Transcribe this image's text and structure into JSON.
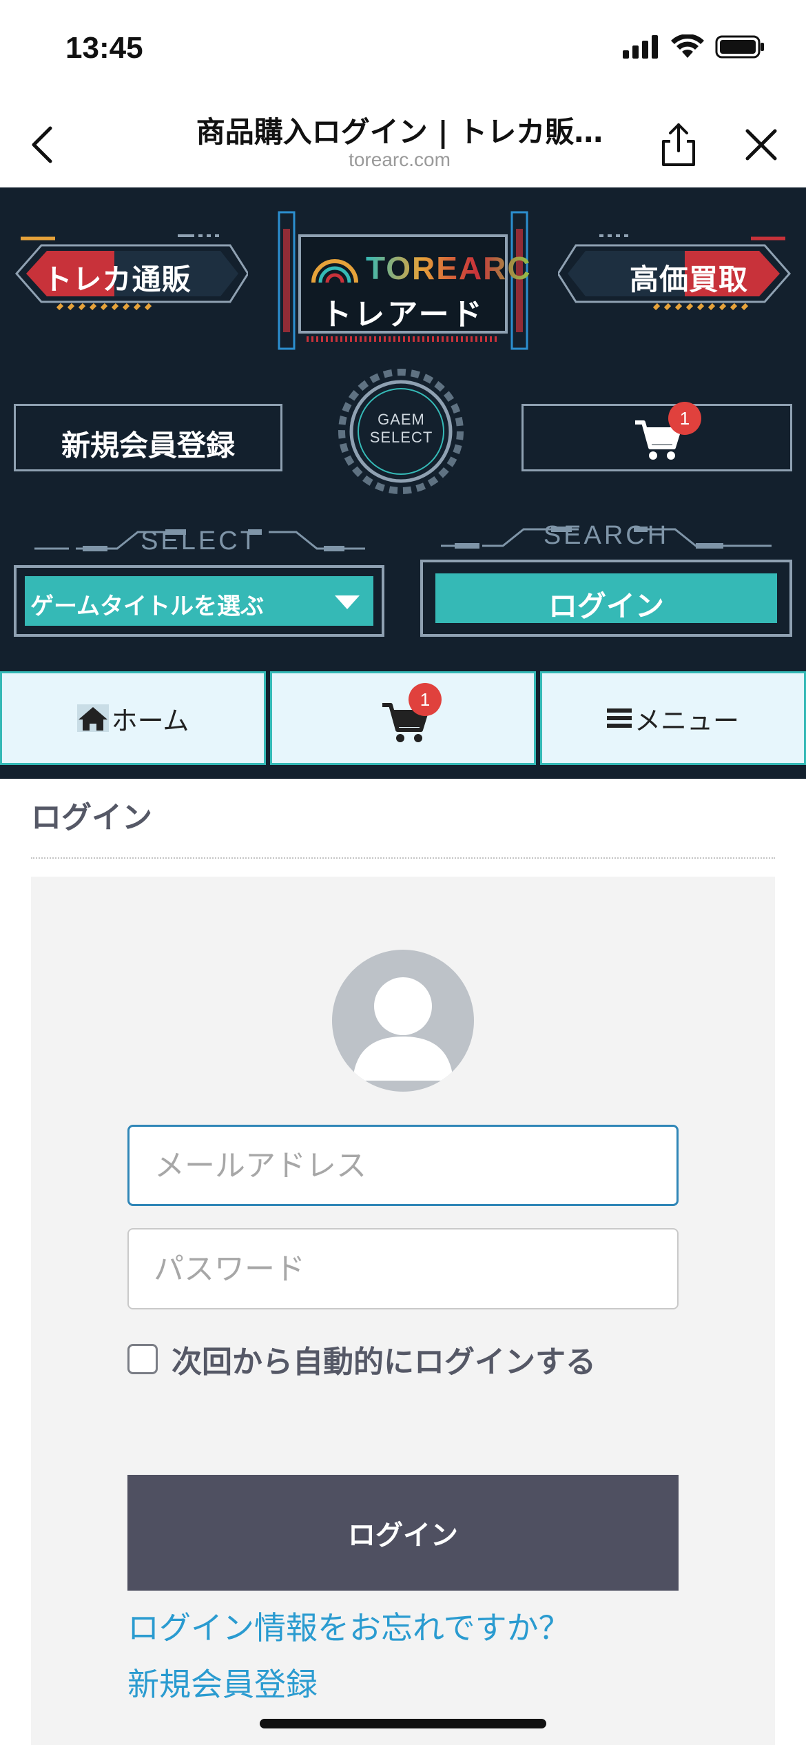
{
  "status_bar": {
    "time": "13:45"
  },
  "browser": {
    "title": "商品購入ログイン | トレカ販…",
    "domain": "torearc.com"
  },
  "header": {
    "left_button": "トレカ通販",
    "right_button": "高価買取",
    "logo_top": "TOREARC",
    "logo_bottom": "トレアード",
    "register_button": "新規会員登録",
    "cart_badge": "1",
    "gear_text_line1": "GAEM",
    "gear_text_line2": "SELECT",
    "select_label": "SELECT",
    "search_label": "SEARCH",
    "select_value": "ゲームタイトルを選ぶ",
    "login_button": "ログイン"
  },
  "nav": {
    "home": "ホーム",
    "cart_badge": "1",
    "menu": "メニュー"
  },
  "main": {
    "section_title": "ログイン",
    "email_placeholder": "メールアドレス",
    "password_placeholder": "パスワード",
    "remember_label": "次回から自動的にログインする",
    "submit_label": "ログイン",
    "forgot_link": "ログイン情報をお忘れですか？",
    "register_link": "新規会員登録"
  },
  "colors": {
    "header_bg": "#13202d",
    "accent_teal": "#35b9b6",
    "accent_red": "#c8323a",
    "badge_red": "#e0413d",
    "link_blue": "#2a9bd0",
    "submit_bg": "#4f5061"
  }
}
